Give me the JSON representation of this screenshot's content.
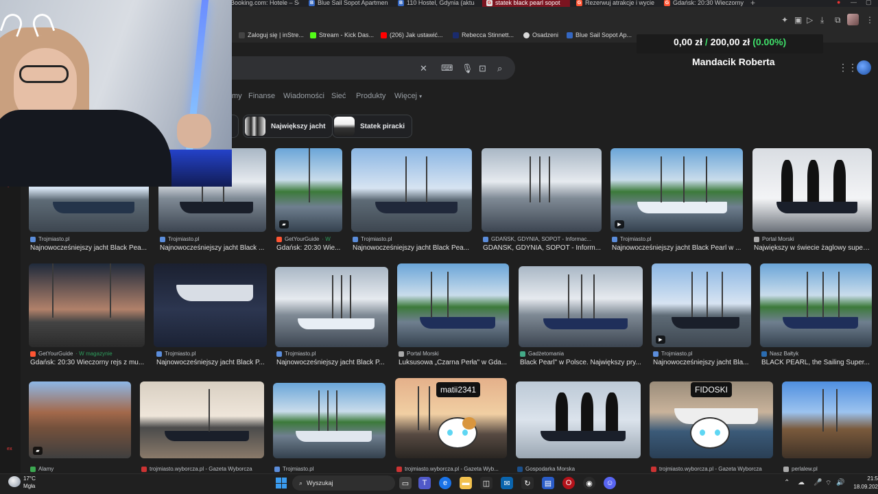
{
  "browser": {
    "tabs": [
      {
        "label": "Booking.com: Hotele – Se",
        "color": "#003580",
        "letter": "B"
      },
      {
        "label": "Blue Sail Sopot Apartmen",
        "color": "#3467c2",
        "letter": "B"
      },
      {
        "label": "110 Hostel, Gdynia (aktua",
        "color": "#3467c2",
        "letter": "B"
      },
      {
        "label": "statek black pearl sopot",
        "color": "#e0e0e0",
        "letter": "G"
      },
      {
        "label": "Rezerwuj atrakcje i wycie",
        "color": "#ff5533",
        "letter": "G"
      },
      {
        "label": "Gdańsk: 20:30 Wieczorny",
        "color": "#ff5533",
        "letter": "G"
      }
    ],
    "new_tab": "+",
    "bookmarks": [
      {
        "label": "Zaloguj się | inStre...",
        "color": "#444"
      },
      {
        "label": "Stream - Kick Das...",
        "color": "#53fc18"
      },
      {
        "label": "(206) Jak ustawić...",
        "color": "#ff0000"
      },
      {
        "label": "Rebecca Stinnett...",
        "color": "#1a2b6d"
      },
      {
        "label": "Osadzeni",
        "color": "#d9d9d9"
      },
      {
        "label": "Blue Sail Sopot Ap...",
        "color": "#3467c2"
      }
    ]
  },
  "overlay": {
    "money_left": "0,00 zł",
    "money_sep": "/",
    "money_right": "200,00 zł",
    "money_pct": "(0.00%)",
    "name": "Mandacik Roberta"
  },
  "search": {
    "clear_icon": "✕",
    "nav_tabs": [
      "my",
      "Finanse",
      "Wiadomości",
      "Sieć",
      "Produkty",
      "Więcej"
    ],
    "more_caret": "▾",
    "chips": [
      {
        "label": "Największy jacht"
      },
      {
        "label": "Statek piracki"
      }
    ]
  },
  "results": [
    {
      "source": "Trojmiasto.pl",
      "title": "Najnowocześniejszy jacht Black Pea..."
    },
    {
      "source": "Trojmiasto.pl",
      "title": "Najnowocześniejszy jacht Black ..."
    },
    {
      "source": "GetYourGuide",
      "mag": "· W",
      "title": "Gdańsk: 20:30 Wie..."
    },
    {
      "source": "Trojmiasto.pl",
      "title": "Najnowocześniejszy jacht Black Pea..."
    },
    {
      "source": "GDAŃSK, GDYNIA, SOPOT - Informac...",
      "title": "GDAŃSK, GDYNIA, SOPOT - Inform..."
    },
    {
      "source": "Trojmiasto.pl",
      "title": "Najnowocześniejszy jacht Black Pearl w ..."
    },
    {
      "source": "Portal Morski",
      "title": "Największy w świecie żaglowy superj..."
    },
    {
      "source": "GetYourGuide",
      "mag": "· W magazynie",
      "title": "Gdańsk: 20:30 Wieczorny rejs z mu..."
    },
    {
      "source": "Trojmiasto.pl",
      "title": "Najnowocześniejszy jacht Black P..."
    },
    {
      "source": "Trojmiasto.pl",
      "title": "Najnowocześniejszy jacht Black P..."
    },
    {
      "source": "Portal Morski",
      "title": "Luksusowa „Czarna Perła\" w Gda..."
    },
    {
      "source": "Gadżetomania",
      "title": "Black Pearl\" w Polsce. Największy pry..."
    },
    {
      "source": "Trojmiasto.pl",
      "title": "Najnowocześniejszy jacht Bla..."
    },
    {
      "source": "Nasz Bałtyk",
      "title": "BLACK PEARL, the Sailing Super..."
    },
    {
      "source": "Alamy",
      "title": ""
    },
    {
      "source": "trojmiasto.wyborcza.pl - Gazeta Wyborcza",
      "title": ""
    },
    {
      "source": "Trojmiasto.pl",
      "title": ""
    },
    {
      "source": "trojmiasto.wyborcza.pl - Gazeta Wyb...",
      "title": ""
    },
    {
      "source": "Gospodarka Morska",
      "title": ""
    },
    {
      "source": "trojmiasto.wyborcza.pl - Gazeta Wyborcza",
      "title": ""
    },
    {
      "source": "perlalew.pl",
      "title": ""
    }
  ],
  "chat": {
    "user1": "matii2341",
    "user2": "FIDOSKI"
  },
  "taskbar": {
    "temp": "17°C",
    "weather": "Mgła",
    "search_label": "Wyszukaj",
    "time": "21:5",
    "date": "18.09.202"
  }
}
